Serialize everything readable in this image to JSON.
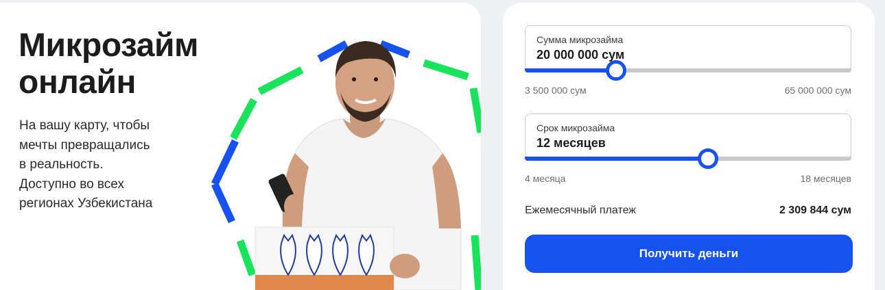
{
  "hero": {
    "title_line1": "Микрозайм",
    "title_line2": "онлайн",
    "subtitle_lines": [
      "На вашу карту, чтобы",
      "мечты превращались",
      "в реальность.",
      "Доступно во всех",
      "регионах Узбекистана"
    ]
  },
  "calculator": {
    "amount": {
      "label": "Сумма микрозайма",
      "value": "20 000 000 сум",
      "min_label": "3 500 000 сум",
      "max_label": "65 000 000 сум",
      "slider_fraction": 0.28
    },
    "term": {
      "label": "Срок микрозайма",
      "value": "12 месяцев",
      "min_label": "4 месяца",
      "max_label": "18 месяцев",
      "slider_fraction": 0.56
    },
    "monthly_payment_label": "Ежемесячный платеж",
    "monthly_payment_value": "2 309 844 сум",
    "cta_label": "Получить деньги"
  },
  "colors": {
    "accent_blue": "#1652f0",
    "accent_green": "#19e35a",
    "track_gray": "#c8c9cc"
  }
}
